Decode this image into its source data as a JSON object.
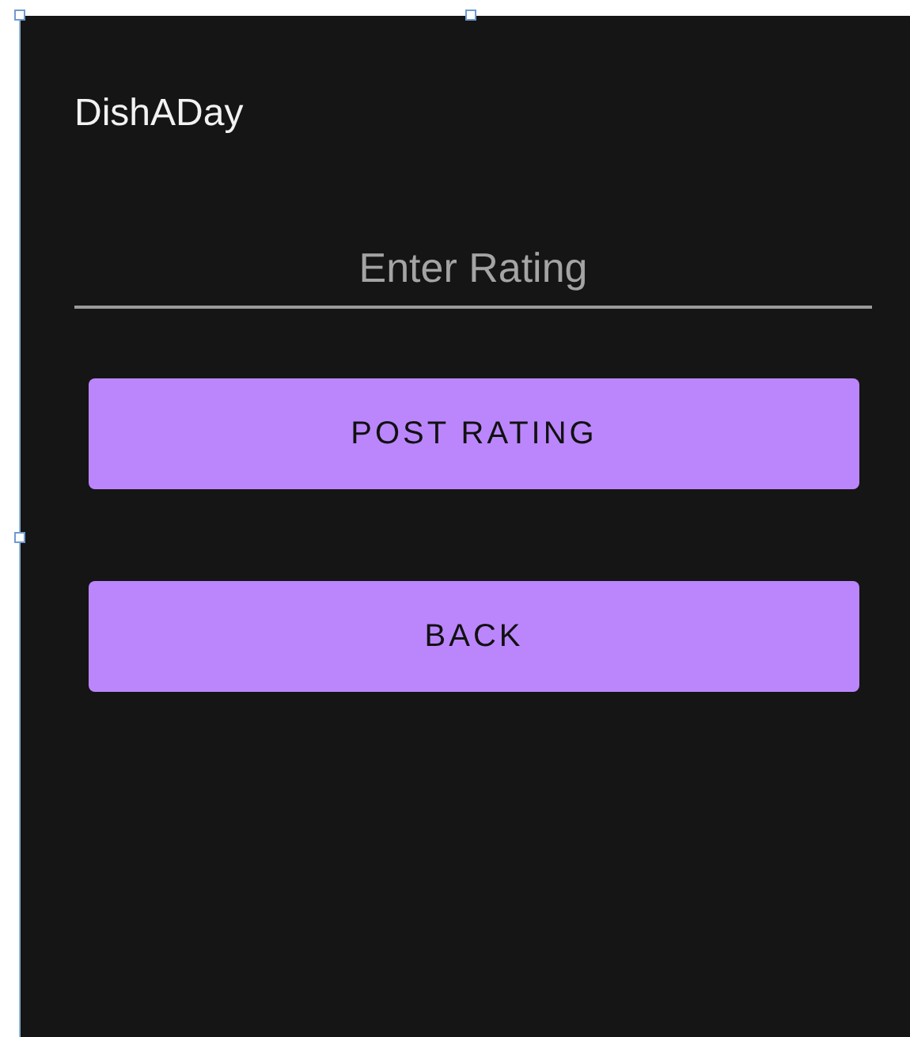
{
  "app_bar": {
    "title": "DishADay"
  },
  "rating_field": {
    "placeholder": "Enter Rating"
  },
  "buttons": [
    {
      "label": "POST RATING"
    },
    {
      "label": "BACK"
    }
  ]
}
